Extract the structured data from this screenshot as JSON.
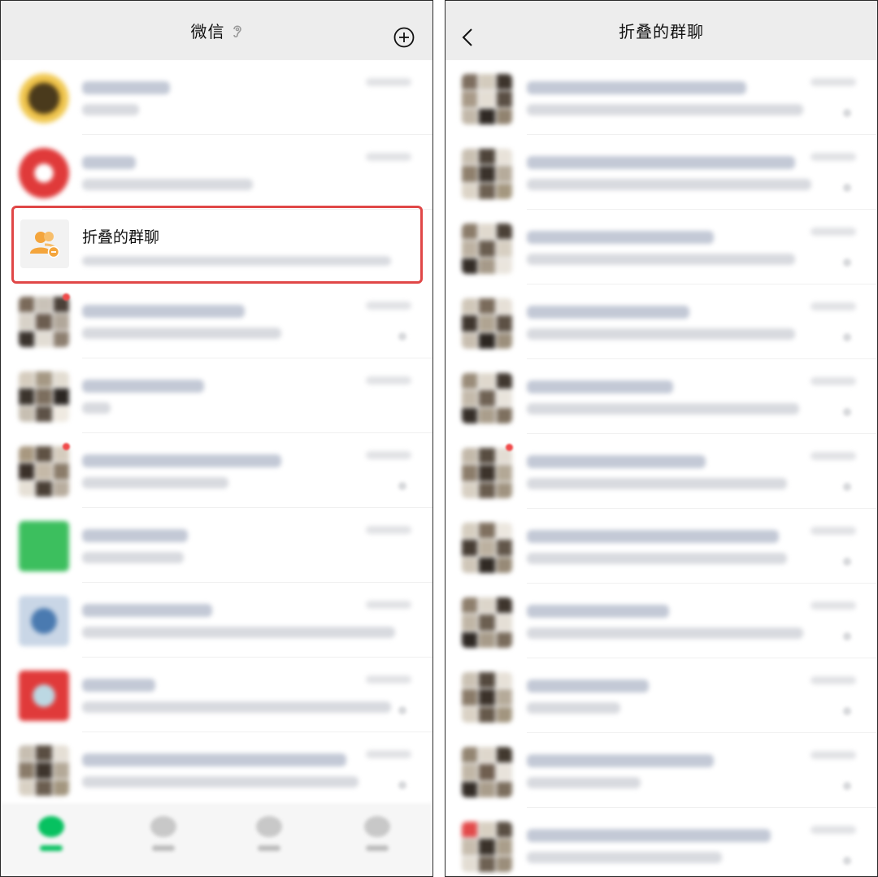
{
  "left_screen": {
    "title": "微信",
    "plus_icon": "plus-circle-icon",
    "ear_icon": "ear-icon",
    "folded_chats_row": {
      "name": "折叠的群聊",
      "icon": "group-chat-folded-icon",
      "icon_color": "#f4a53c"
    },
    "highlight_color": "#e04747"
  },
  "right_screen": {
    "title": "折叠的群聊",
    "back_icon": "chevron-left-icon"
  },
  "colors": {
    "header_bg": "#ededed",
    "wechat_green": "#07c160",
    "badge_red": "#f04a4a"
  }
}
